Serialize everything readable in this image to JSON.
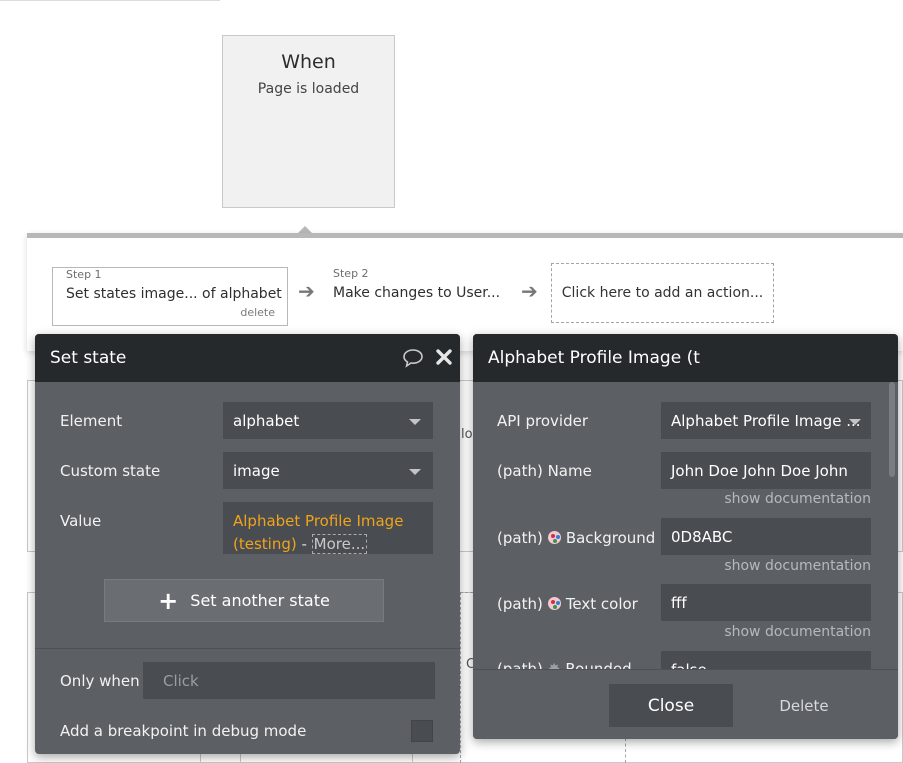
{
  "event": {
    "title": "When",
    "subtitle": "Page is loaded"
  },
  "steps": [
    {
      "label": "Step 1",
      "title": "Set states image... of alphabet",
      "delete": "delete"
    },
    {
      "label": "Step 2",
      "title": "Make changes to User..."
    }
  ],
  "add_action": "Click here to add an action...",
  "background_fragments": {
    "lo": "lo",
    "c": "C"
  },
  "set_state": {
    "title": "Set state",
    "comment_icon": "speech-bubble-icon",
    "close_icon": "close-icon",
    "element_label": "Element",
    "element_value": "alphabet",
    "custom_state_label": "Custom state",
    "custom_state_value": "image",
    "value_label": "Value",
    "value_expression": "Alphabet Profile Image (testing)",
    "value_separator": " - ",
    "value_more": "More...",
    "add_state_button": "Set another state",
    "only_when_label": "Only when",
    "only_when_placeholder": "Click",
    "breakpoint_label": "Add a breakpoint in debug mode"
  },
  "api_panel": {
    "title": "Alphabet Profile Image (t",
    "api_provider_label": "API provider",
    "api_provider_value": "Alphabet Profile Image ...",
    "name_label": "(path) Name",
    "name_value": "John Doe John Doe John",
    "background_prefix": "(path)",
    "background_label": "Background",
    "background_value": "0D8ABC",
    "text_color_prefix": "(path)",
    "text_color_label": "Text color",
    "text_color_value": "fff",
    "rounded_prefix": "(path)",
    "rounded_label": "Rounded",
    "rounded_value": "false",
    "show_documentation": "show documentation",
    "close_button": "Close",
    "delete_button": "Delete"
  },
  "colors": {
    "panel_body": "#5c6064",
    "panel_header": "#25292c",
    "field_bg": "#494d51",
    "expression_orange": "#f0a31c"
  }
}
